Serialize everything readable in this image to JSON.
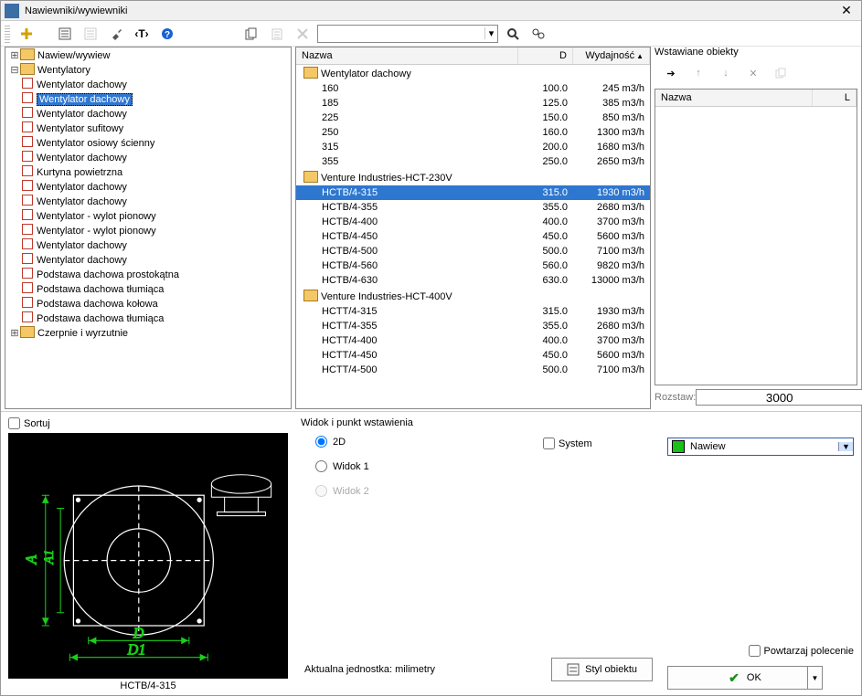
{
  "window": {
    "title": "Nawiewniki/wywiewniki"
  },
  "toolbar": {
    "search_placeholder": ""
  },
  "tree": {
    "root": [
      {
        "label": "Nawiew/wywiew",
        "exp": "+"
      },
      {
        "label": "Wentylatory",
        "exp": "−",
        "children": [
          "Wentylator dachowy",
          "Wentylator dachowy",
          "Wentylator dachowy",
          "Wentylator sufitowy",
          "Wentylator osiowy ścienny",
          "Wentylator dachowy",
          "Kurtyna powietrzna",
          "Wentylator dachowy",
          "Wentylator dachowy",
          "Wentylator - wylot pionowy",
          "Wentylator - wylot pionowy",
          "Wentylator dachowy",
          "Wentylator dachowy",
          "Podstawa dachowa prostokątna",
          "Podstawa dachowa tłumiąca",
          "Podstawa dachowa kołowa",
          "Podstawa dachowa tłumiąca"
        ],
        "selected_index": 1
      },
      {
        "label": "Czerpnie i wyrzutnie",
        "exp": "+"
      }
    ]
  },
  "list": {
    "columns": {
      "name": "Nazwa",
      "d": "D",
      "cap": "Wydajność"
    },
    "groups": [
      {
        "label": "Wentylator dachowy",
        "rows": [
          {
            "name": "160",
            "d": "100.0",
            "cap": "245 m3/h"
          },
          {
            "name": "185",
            "d": "125.0",
            "cap": "385 m3/h"
          },
          {
            "name": "225",
            "d": "150.0",
            "cap": "850 m3/h"
          },
          {
            "name": "250",
            "d": "160.0",
            "cap": "1300 m3/h"
          },
          {
            "name": "315",
            "d": "200.0",
            "cap": "1680 m3/h"
          },
          {
            "name": "355",
            "d": "250.0",
            "cap": "2650 m3/h"
          }
        ]
      },
      {
        "label": "Venture Industries-HCT-230V",
        "rows": [
          {
            "name": "HCTB/4-315",
            "d": "315.0",
            "cap": "1930 m3/h",
            "sel": true
          },
          {
            "name": "HCTB/4-355",
            "d": "355.0",
            "cap": "2680 m3/h"
          },
          {
            "name": "HCTB/4-400",
            "d": "400.0",
            "cap": "3700 m3/h"
          },
          {
            "name": "HCTB/4-450",
            "d": "450.0",
            "cap": "5600 m3/h"
          },
          {
            "name": "HCTB/4-500",
            "d": "500.0",
            "cap": "7100 m3/h"
          },
          {
            "name": "HCTB/4-560",
            "d": "560.0",
            "cap": "9820 m3/h"
          },
          {
            "name": "HCTB/4-630",
            "d": "630.0",
            "cap": "13000 m3/h"
          }
        ]
      },
      {
        "label": "Venture Industries-HCT-400V",
        "rows": [
          {
            "name": "HCTT/4-315",
            "d": "315.0",
            "cap": "1930 m3/h"
          },
          {
            "name": "HCTT/4-355",
            "d": "355.0",
            "cap": "2680 m3/h"
          },
          {
            "name": "HCTT/4-400",
            "d": "400.0",
            "cap": "3700 m3/h"
          },
          {
            "name": "HCTT/4-450",
            "d": "450.0",
            "cap": "5600 m3/h"
          },
          {
            "name": "HCTT/4-500",
            "d": "500.0",
            "cap": "7100 m3/h"
          }
        ]
      }
    ]
  },
  "right": {
    "title": "Wstawiane obiekty",
    "columns": {
      "name": "Nazwa",
      "l": "L"
    },
    "spacing_label": "Rozstaw:",
    "spacing_value": "3000"
  },
  "preview": {
    "sort_label": "Sortuj",
    "caption": "HCTB/4-315",
    "dim_A": "A",
    "dim_A1": "A1",
    "dim_D": "D",
    "dim_D1": "D1"
  },
  "viewgroup": {
    "title": "Widok i punkt wstawienia",
    "r1": "2D",
    "r2": "Widok 1",
    "r3": "Widok 2",
    "system_label": "System"
  },
  "nawiew": {
    "combo_value": "Nawiew",
    "repeat_label": "Powtarzaj polecenie"
  },
  "bottom": {
    "unit_label": "Aktualna jednostka: milimetry",
    "style_btn": "Styl obiektu",
    "ok_btn": "OK"
  }
}
